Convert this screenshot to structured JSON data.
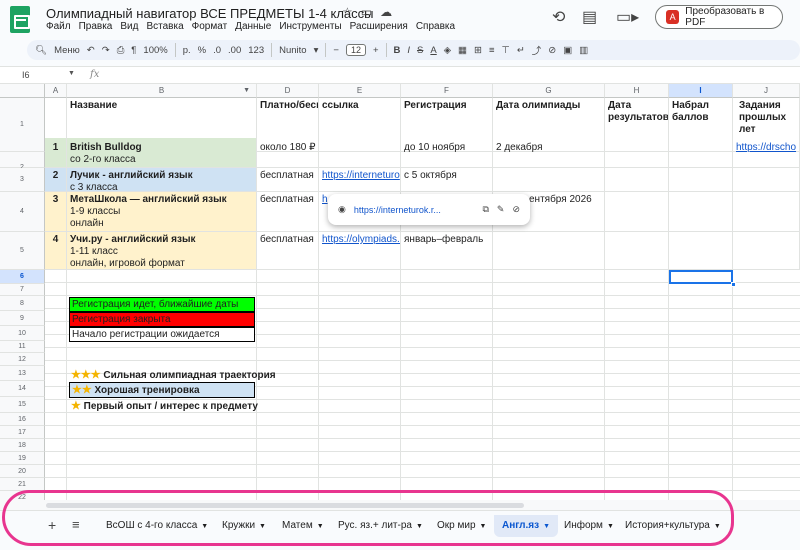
{
  "header": {
    "title": "Олимпиадный навигатор ВСЕ ПРЕДМЕТЫ 1-4 классы",
    "menu": [
      "Файл",
      "Правка",
      "Вид",
      "Вставка",
      "Формат",
      "Данные",
      "Инструменты",
      "Расширения",
      "Справка"
    ],
    "pdf_button": "Преобразовать в PDF"
  },
  "toolbar": {
    "menu_label": "Меню",
    "zoom": "100%",
    "currency": "р.",
    "percent": "%",
    "dec_dec": ".0",
    "dec_inc": ".00",
    "format_123": "123",
    "font": "Nunito",
    "font_size": "12"
  },
  "formula_bar": {
    "cell_ref": "I6",
    "fx": "fx"
  },
  "columns": [
    "A",
    "B",
    "C",
    "D",
    "E",
    "F",
    "G",
    "H",
    "I",
    "J"
  ],
  "rows": [
    "1",
    "2",
    "3",
    "4",
    "5",
    "6",
    "7",
    "8",
    "9",
    "10",
    "11",
    "12",
    "13",
    "14",
    "15",
    "16",
    "17",
    "18",
    "19",
    "20",
    "21",
    "22"
  ],
  "headers": {
    "b": "Название",
    "d": "Платно/бесп",
    "e": "ссылка",
    "f": "Регистрация",
    "g": "Дата олимпиады",
    "h": "Дата результатов",
    "i": "Набрал баллов",
    "j": "Задания прошлых лет"
  },
  "data_rows": [
    {
      "num": "1",
      "name": "British Bulldog",
      "sub1": "со 2-го класса",
      "sub2": "",
      "price": "около 180 ₽",
      "link": "",
      "reg": "до 10 ноября",
      "date": "2 декабря",
      "past": "https://drscho"
    },
    {
      "num": "2",
      "name": "Лучик - английский язык",
      "sub1": "с 3 класса",
      "sub2": "",
      "price": "бесплатная",
      "link": "https://interneturo",
      "reg": "с 5 октября",
      "date": "",
      "past": ""
    },
    {
      "num": "3",
      "name": "МетаШкола — английский язык",
      "sub1": "1-9 классы",
      "sub2": "онлайн",
      "price": "бесплатная",
      "link": "h",
      "reg": "",
      "date": "ентября 2026",
      "past": ""
    },
    {
      "num": "4",
      "name": "Учи.ру  - английский язык",
      "sub1": "1-11 класс",
      "sub2": "онлайн, игровой формат",
      "price": "бесплатная",
      "link": "https://olympiads.u",
      "reg": "январь–февраль",
      "date": "",
      "past": ""
    }
  ],
  "legend": {
    "open": "Регистрация идет, ближайшие даты",
    "closed": "Регистрация закрыта",
    "pending": "Начало регистрации ожидается",
    "open_color": "#00ff00",
    "closed_color": "#ff0000"
  },
  "ratings": {
    "three": "Сильная олимпиадная траектория",
    "two": "Хорошая тренировка",
    "one": "Первый опыт / интерес к предмету"
  },
  "link_popup": {
    "url": "https://interneturok.r..."
  },
  "tabs": [
    "ВсОШ с 4-го класса",
    "Кружки",
    "Матем",
    "Рус. яз.+ лит-ра",
    "Окр мир",
    "Англ.яз",
    "Информ",
    "История+культура"
  ],
  "active_tab": "Англ.яз"
}
